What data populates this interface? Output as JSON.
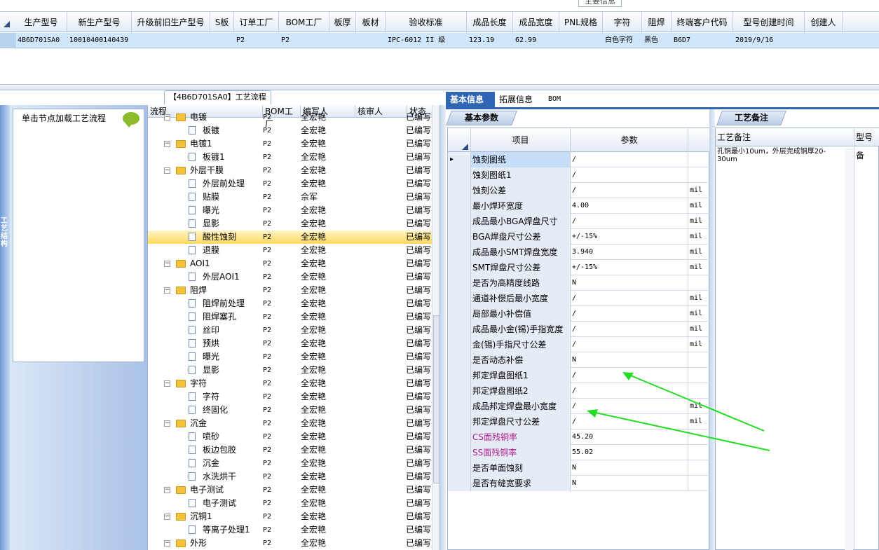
{
  "top_grid": {
    "legend": "主要信息",
    "columns": [
      "生产型号",
      "新生产型号",
      "升级前旧生产型号",
      "S板",
      "订单工厂",
      "BOM工厂",
      "板厚",
      "板材",
      "验收标准",
      "成品长度",
      "成品宽度",
      "PNL规格",
      "字符",
      "阻焊",
      "终端客户代码",
      "型号创建时间",
      "创建人"
    ],
    "row": [
      "4B6D701SA0",
      "10010400140439",
      "",
      "",
      "P2",
      "P2",
      "",
      "",
      "IPC-6012 II 级",
      "123.19",
      "62.99",
      "",
      "白色字符",
      "黑色",
      "B6D7",
      "2019/9/16",
      ""
    ]
  },
  "left_panel": {
    "side_tab": "工艺结构",
    "title": "单击节点加载工艺流程",
    "icon": "speech-bubble-icon"
  },
  "tree": {
    "title": "【4B6D701SA0】工艺流程",
    "columns": [
      "流程",
      "BOM工厂",
      "编写人",
      "核审人",
      "状态"
    ],
    "rows": [
      {
        "level": 0,
        "name": "电镀",
        "factory": "P2",
        "writer": "全宏艳",
        "status": "已编写"
      },
      {
        "level": 1,
        "name": "板镀",
        "factory": "P2",
        "writer": "全宏艳",
        "status": "已编写"
      },
      {
        "level": 0,
        "name": "电镀1",
        "factory": "P2",
        "writer": "全宏艳",
        "status": "已编写"
      },
      {
        "level": 1,
        "name": "板镀1",
        "factory": "P2",
        "writer": "全宏艳",
        "status": "已编写"
      },
      {
        "level": 0,
        "name": "外层干膜",
        "factory": "P2",
        "writer": "全宏艳",
        "status": "已编写"
      },
      {
        "level": 1,
        "name": "外层前处理",
        "factory": "P2",
        "writer": "全宏艳",
        "status": "已编写"
      },
      {
        "level": 1,
        "name": "贴膜",
        "factory": "P2",
        "writer": "佘军",
        "status": "已编写"
      },
      {
        "level": 1,
        "name": "曝光",
        "factory": "P2",
        "writer": "全宏艳",
        "status": "已编写"
      },
      {
        "level": 1,
        "name": "显影",
        "factory": "P2",
        "writer": "全宏艳",
        "status": "已编写"
      },
      {
        "level": 1,
        "name": "酸性蚀刻",
        "factory": "P2",
        "writer": "全宏艳",
        "status": "已编写",
        "selected": true
      },
      {
        "level": 1,
        "name": "退膜",
        "factory": "P2",
        "writer": "全宏艳",
        "status": "已编写"
      },
      {
        "level": 0,
        "name": "AOI1",
        "factory": "P2",
        "writer": "全宏艳",
        "status": "已编写"
      },
      {
        "level": 1,
        "name": "外层AOI1",
        "factory": "P2",
        "writer": "全宏艳",
        "status": "已编写"
      },
      {
        "level": 0,
        "name": "阻焊",
        "factory": "P2",
        "writer": "全宏艳",
        "status": "已编写"
      },
      {
        "level": 1,
        "name": "阻焊前处理",
        "factory": "P2",
        "writer": "全宏艳",
        "status": "已编写"
      },
      {
        "level": 1,
        "name": "阻焊塞孔",
        "factory": "P2",
        "writer": "全宏艳",
        "status": "已编写"
      },
      {
        "level": 1,
        "name": "丝印",
        "factory": "P2",
        "writer": "全宏艳",
        "status": "已编写"
      },
      {
        "level": 1,
        "name": "预烘",
        "factory": "P2",
        "writer": "全宏艳",
        "status": "已编写"
      },
      {
        "level": 1,
        "name": "曝光",
        "factory": "P2",
        "writer": "全宏艳",
        "status": "已编写"
      },
      {
        "level": 1,
        "name": "显影",
        "factory": "P2",
        "writer": "全宏艳",
        "status": "已编写"
      },
      {
        "level": 0,
        "name": "字符",
        "factory": "P2",
        "writer": "全宏艳",
        "status": "已编写"
      },
      {
        "level": 1,
        "name": "字符",
        "factory": "P2",
        "writer": "全宏艳",
        "status": "已编写"
      },
      {
        "level": 1,
        "name": "终固化",
        "factory": "P2",
        "writer": "全宏艳",
        "status": "已编写"
      },
      {
        "level": 0,
        "name": "沉金",
        "factory": "P2",
        "writer": "全宏艳",
        "status": "已编写"
      },
      {
        "level": 1,
        "name": "喷砂",
        "factory": "P2",
        "writer": "全宏艳",
        "status": "已编写"
      },
      {
        "level": 1,
        "name": "板边包胶",
        "factory": "P2",
        "writer": "全宏艳",
        "status": "已编写"
      },
      {
        "level": 1,
        "name": "沉金",
        "factory": "P2",
        "writer": "全宏艳",
        "status": "已编写"
      },
      {
        "level": 1,
        "name": "水洗烘干",
        "factory": "P2",
        "writer": "全宏艳",
        "status": "已编写"
      },
      {
        "level": 0,
        "name": "电子测试",
        "factory": "P2",
        "writer": "全宏艳",
        "status": "已编写"
      },
      {
        "level": 1,
        "name": "电子测试",
        "factory": "P2",
        "writer": "全宏艳",
        "status": "已编写"
      },
      {
        "level": 0,
        "name": "沉铜1",
        "factory": "P2",
        "writer": "全宏艳",
        "status": "已编写"
      },
      {
        "level": 1,
        "name": "等离子处理1",
        "factory": "P2",
        "writer": "全宏艳",
        "status": "已编写"
      },
      {
        "level": 0,
        "name": "外形",
        "factory": "P2",
        "writer": "全宏艳",
        "status": "已编写"
      }
    ]
  },
  "tabs": [
    "基本信息",
    "拓展信息",
    "BOM"
  ],
  "params": {
    "tab": "基本参数",
    "columns": [
      "项目",
      "参数"
    ],
    "rows": [
      {
        "item": "蚀刻图纸",
        "value": "/",
        "unit": "",
        "selected": true
      },
      {
        "item": "蚀刻图纸1",
        "value": "/",
        "unit": ""
      },
      {
        "item": "蚀刻公差",
        "value": "/",
        "unit": "mil"
      },
      {
        "item": "最小焊环宽度",
        "value": "4.00",
        "unit": "mil"
      },
      {
        "item": "成品最小BGA焊盘尺寸",
        "value": "/",
        "unit": "mil"
      },
      {
        "item": "BGA焊盘尺寸公差",
        "value": "+/-15%",
        "unit": "mil"
      },
      {
        "item": "成品最小SMT焊盘宽度",
        "value": "3.940",
        "unit": "mil"
      },
      {
        "item": "SMT焊盘尺寸公差",
        "value": "+/-15%",
        "unit": "mil"
      },
      {
        "item": "是否为高精度线路",
        "value": "N",
        "unit": ""
      },
      {
        "item": "通道补偿后最小宽度",
        "value": "/",
        "unit": "mil"
      },
      {
        "item": "局部最小补偿值",
        "value": "/",
        "unit": "mil"
      },
      {
        "item": "成品最小金(锡)手指宽度",
        "value": "/",
        "unit": "mil"
      },
      {
        "item": "金(锡)手指尺寸公差",
        "value": "/",
        "unit": "mil"
      },
      {
        "item": "是否动态补偿",
        "value": "N",
        "unit": ""
      },
      {
        "item": "邦定焊盘图纸1",
        "value": "/",
        "unit": ""
      },
      {
        "item": "邦定焊盘图纸2",
        "value": "/",
        "unit": ""
      },
      {
        "item": "成品邦定焊盘最小宽度",
        "value": "/",
        "unit": "mil"
      },
      {
        "item": "邦定焊盘尺寸公差",
        "value": "/",
        "unit": "mil"
      },
      {
        "item": "CS面残铜率",
        "value": "45.20",
        "unit": "",
        "pink": true
      },
      {
        "item": "SS面残铜率",
        "value": "55.02",
        "unit": "",
        "pink": true
      },
      {
        "item": "是否单面蚀刻",
        "value": "N",
        "unit": ""
      },
      {
        "item": "是否有缝宽要求",
        "value": "N",
        "unit": ""
      }
    ]
  },
  "remark": {
    "tab": "工艺备注",
    "columns": [
      "工艺备注",
      "型号备"
    ],
    "text": "孔铜最小10um，外层完成铜厚20-30um"
  },
  "annotation_color": "#22dd22"
}
